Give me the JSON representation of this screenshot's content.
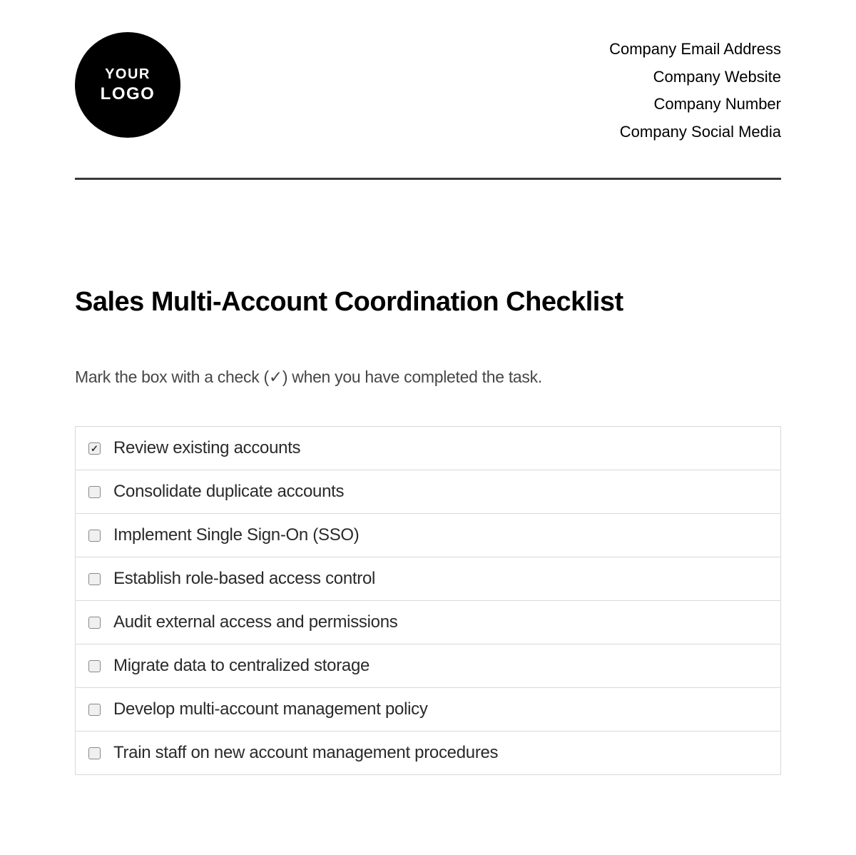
{
  "logo": {
    "line1": "YOUR",
    "line2": "LOGO"
  },
  "company_info": [
    "Company Email Address",
    "Company Website",
    "Company Number",
    "Company Social Media"
  ],
  "title": "Sales Multi-Account Coordination Checklist",
  "instructions": "Mark the box with a check (✓) when you have completed the task.",
  "checklist": [
    {
      "label": "Review existing accounts",
      "checked": true
    },
    {
      "label": "Consolidate duplicate accounts",
      "checked": false
    },
    {
      "label": "Implement Single Sign-On (SSO)",
      "checked": false
    },
    {
      "label": "Establish role-based access control",
      "checked": false
    },
    {
      "label": "Audit external access and permissions",
      "checked": false
    },
    {
      "label": "Migrate data to centralized storage",
      "checked": false
    },
    {
      "label": "Develop multi-account management policy",
      "checked": false
    },
    {
      "label": "Train staff on new account management procedures",
      "checked": false
    }
  ]
}
